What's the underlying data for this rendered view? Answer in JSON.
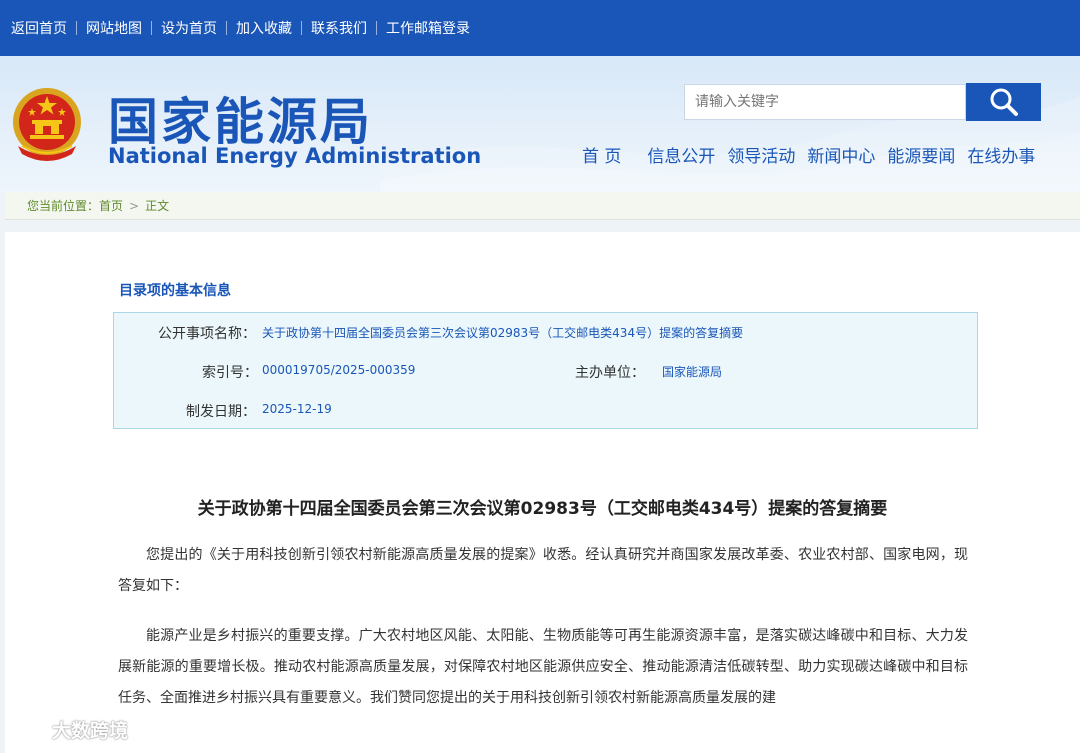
{
  "topbar": {
    "links": [
      "返回首页",
      "网站地图",
      "设为首页",
      "加入收藏",
      "联系我们",
      "工作邮箱登录"
    ]
  },
  "header": {
    "logo_cn": "国家能源局",
    "logo_en": "National Energy Administration",
    "search_placeholder": "请输入关键字",
    "nav": [
      "首 页",
      "信息公开",
      "领导活动",
      "新闻中心",
      "能源要闻",
      "在线办事"
    ]
  },
  "breadcrumb": {
    "prefix": "您当前位置：",
    "home": "首页",
    "current": "正文"
  },
  "info": {
    "section_title": "目录项的基本信息",
    "name_label": "公开事项名称：",
    "name_value": "关于政协第十四届全国委员会第三次会议第02983号（工交邮电类434号）提案的答复摘要",
    "index_label": "索引号：",
    "index_value": "000019705/2025-000359",
    "unit_label": "主办单位：",
    "unit_value": "国家能源局",
    "date_label": "制发日期：",
    "date_value": "2025-12-19"
  },
  "article": {
    "title": "关于政协第十四届全国委员会第三次会议第02983号（工交邮电类434号）提案的答复摘要",
    "paragraphs": [
      "您提出的《关于用科技创新引领农村新能源高质量发展的提案》收悉。经认真研究并商国家发展改革委、农业农村部、国家电网，现答复如下：",
      "能源产业是乡村振兴的重要支撑。广大农村地区风能、太阳能、生物质能等可再生能源资源丰富，是落实碳达峰碳中和目标、大力发展新能源的重要增长极。推动农村能源高质量发展，对保障农村地区能源供应安全、推动能源清洁低碳转型、助力实现碳达峰碳中和目标任务、全面推进乡村振兴具有重要意义。我们赞同您提出的关于用科技创新引领农村新能源高质量发展的建"
    ]
  },
  "watermark": {
    "text": "大数跨境"
  },
  "colors": {
    "brand_blue": "#1a56b8",
    "info_bg": "#ebf7fb",
    "breadcrumb_green": "#5f8a2c"
  }
}
